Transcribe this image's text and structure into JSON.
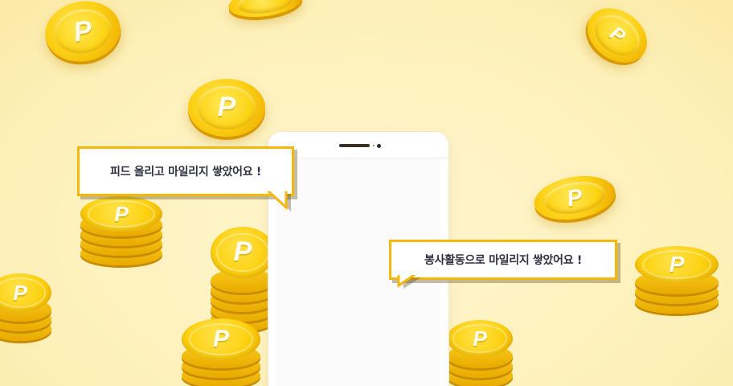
{
  "bubbles": {
    "feed": "피드 올리고 마일리지 쌓았어요 !",
    "volunteer": "봉사활동으로 마일리지 쌓았어요 !"
  },
  "coin_symbol": "P",
  "colors": {
    "background": "#fef3c0",
    "coin": "#fcd116",
    "bubble_border": "#f4b70a",
    "text": "#2f3140"
  },
  "icons": [
    "coin-icon",
    "coin-stack-icon",
    "phone-speaker-icon",
    "phone-camera-icon"
  ]
}
